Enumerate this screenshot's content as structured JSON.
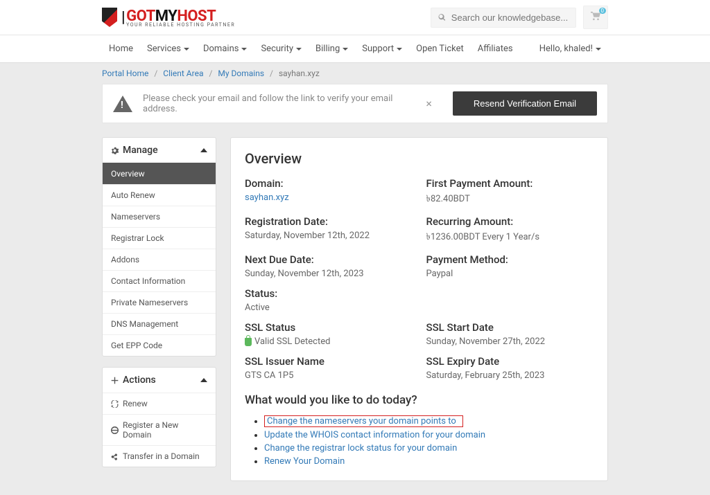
{
  "logo": {
    "got": "GOT",
    "my": "MY",
    "host": "HOST",
    "tagline": "YOUR RELIABLE HOSTING PARTNER"
  },
  "search": {
    "placeholder": "Search our knowledgebase..."
  },
  "cart": {
    "count": "0"
  },
  "nav": {
    "home": "Home",
    "services": "Services",
    "domains": "Domains",
    "security": "Security",
    "billing": "Billing",
    "support": "Support",
    "open_ticket": "Open Ticket",
    "affiliates": "Affiliates"
  },
  "user_menu": "Hello, khaled!",
  "breadcrumb": {
    "portal_home": "Portal Home",
    "client_area": "Client Area",
    "my_domains": "My Domains",
    "current": "sayhan.xyz"
  },
  "alert": {
    "text": "Please check your email and follow the link to verify your email address.",
    "resend": "Resend Verification Email"
  },
  "sidebar": {
    "manage": {
      "title": "Manage",
      "overview": "Overview",
      "auto_renew": "Auto Renew",
      "nameservers": "Nameservers",
      "registrar_lock": "Registrar Lock",
      "addons": "Addons",
      "contact_info": "Contact Information",
      "private_ns": "Private Nameservers",
      "dns_mgmt": "DNS Management",
      "epp": "Get EPP Code"
    },
    "actions": {
      "title": "Actions",
      "renew": "Renew",
      "register": "Register a New Domain",
      "transfer": "Transfer in a Domain"
    }
  },
  "overview": {
    "title": "Overview",
    "domain_label": "Domain:",
    "domain": "sayhan.xyz",
    "first_payment_label": "First Payment Amount:",
    "first_payment": "৳82.40BDT",
    "reg_date_label": "Registration Date:",
    "reg_date": "Saturday, November 12th, 2022",
    "recurring_label": "Recurring Amount:",
    "recurring": "৳1236.00BDT Every 1 Year/s",
    "next_due_label": "Next Due Date:",
    "next_due": "Sunday, November 12th, 2023",
    "payment_method_label": "Payment Method:",
    "payment_method": "Paypal",
    "status_label": "Status:",
    "status": "Active",
    "ssl_status_label": "SSL Status",
    "ssl_status": "Valid SSL Detected",
    "ssl_start_label": "SSL Start Date",
    "ssl_start": "Sunday, November 27th, 2022",
    "ssl_issuer_label": "SSL Issuer Name",
    "ssl_issuer": "GTS CA 1P5",
    "ssl_expiry_label": "SSL Expiry Date",
    "ssl_expiry": "Saturday, February 25th, 2023",
    "todo_title": "What would you like to do today?",
    "todo": {
      "nameservers": "Change the nameservers your domain points to",
      "whois": "Update the WHOIS contact information for your domain",
      "lock": "Change the registrar lock status for your domain",
      "renew": "Renew Your Domain"
    }
  }
}
